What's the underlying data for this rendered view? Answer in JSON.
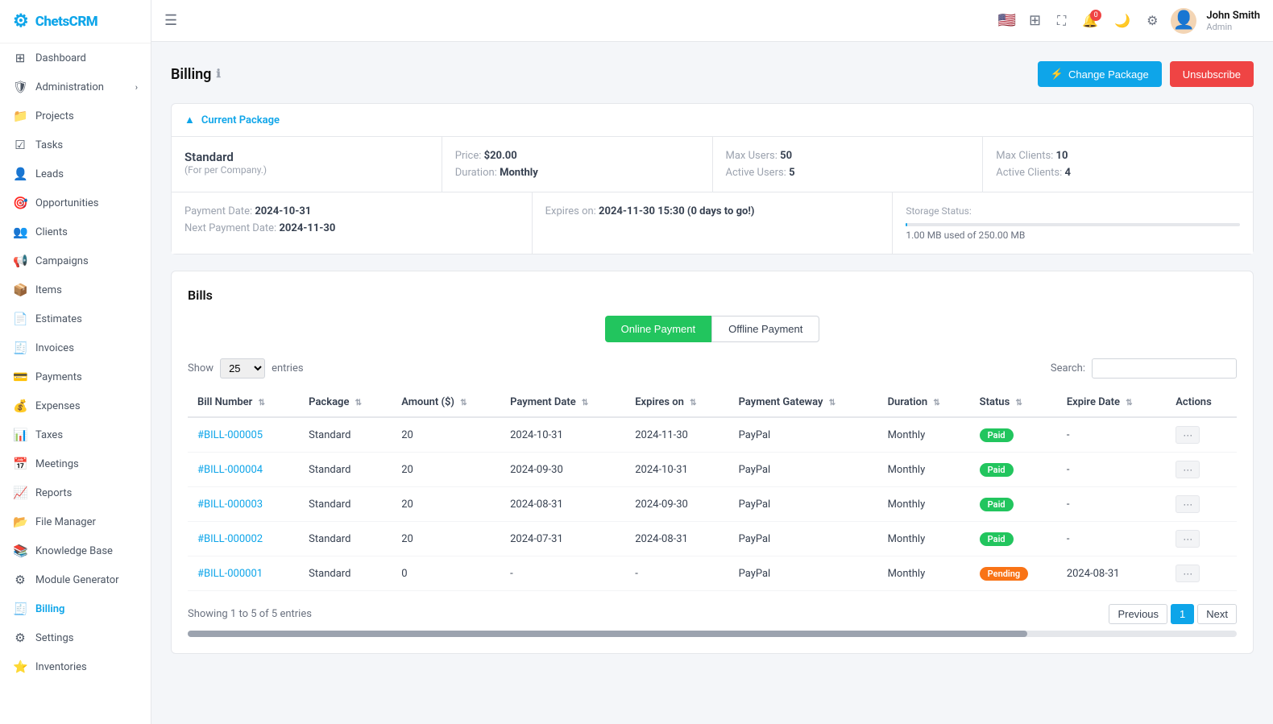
{
  "app": {
    "name": "ChetsCRM",
    "logo_icon": "⚙"
  },
  "topbar": {
    "hamburger_icon": "☰",
    "flag_icon": "🇺🇸",
    "grid_icon": "⊞",
    "fullscreen_icon": "⛶",
    "notification_icon": "🔔",
    "notification_count": "0",
    "moon_icon": "🌙",
    "settings_icon": "⚙",
    "user_name": "John Smith",
    "user_role": "Admin"
  },
  "sidebar": {
    "items": [
      {
        "id": "dashboard",
        "label": "Dashboard",
        "icon": "⊞"
      },
      {
        "id": "administration",
        "label": "Administration",
        "icon": "🛡",
        "has_chevron": true
      },
      {
        "id": "projects",
        "label": "Projects",
        "icon": "📁"
      },
      {
        "id": "tasks",
        "label": "Tasks",
        "icon": "☑"
      },
      {
        "id": "leads",
        "label": "Leads",
        "icon": "👤"
      },
      {
        "id": "opportunities",
        "label": "Opportunities",
        "icon": "🎯"
      },
      {
        "id": "clients",
        "label": "Clients",
        "icon": "👥"
      },
      {
        "id": "campaigns",
        "label": "Campaigns",
        "icon": "📢"
      },
      {
        "id": "items",
        "label": "Items",
        "icon": "📦"
      },
      {
        "id": "estimates",
        "label": "Estimates",
        "icon": "📄"
      },
      {
        "id": "invoices",
        "label": "Invoices",
        "icon": "🧾"
      },
      {
        "id": "payments",
        "label": "Payments",
        "icon": "💳"
      },
      {
        "id": "expenses",
        "label": "Expenses",
        "icon": "💰"
      },
      {
        "id": "taxes",
        "label": "Taxes",
        "icon": "📊"
      },
      {
        "id": "meetings",
        "label": "Meetings",
        "icon": "📅"
      },
      {
        "id": "reports",
        "label": "Reports",
        "icon": "📈"
      },
      {
        "id": "file-manager",
        "label": "File Manager",
        "icon": "📂"
      },
      {
        "id": "knowledge-base",
        "label": "Knowledge Base",
        "icon": "📚"
      },
      {
        "id": "module-generator",
        "label": "Module Generator",
        "icon": "⚙"
      },
      {
        "id": "billing",
        "label": "Billing",
        "icon": "🧾",
        "active": true
      },
      {
        "id": "settings",
        "label": "Settings",
        "icon": "⚙"
      },
      {
        "id": "inventories",
        "label": "Inventories",
        "icon": "⭐"
      }
    ]
  },
  "page": {
    "title": "Billing",
    "change_package_label": "Change Package",
    "unsubscribe_label": "Unsubscribe"
  },
  "current_package": {
    "section_title": "Current Package",
    "package_name": "Standard",
    "package_sub": "(For per Company.)",
    "price_label": "Price:",
    "price_value": "$20.00",
    "duration_label": "Duration:",
    "duration_value": "Monthly",
    "max_users_label": "Max Users:",
    "max_users_value": "50",
    "active_users_label": "Active Users:",
    "active_users_value": "5",
    "max_clients_label": "Max Clients:",
    "max_clients_value": "10",
    "active_clients_label": "Active Clients:",
    "active_clients_value": "4",
    "payment_date_label": "Payment Date:",
    "payment_date_value": "2024-10-31",
    "next_payment_label": "Next Payment Date:",
    "next_payment_value": "2024-11-30",
    "expires_label": "Expires on:",
    "expires_value": "2024-11-30 15:30 (0 days to go!)",
    "storage_label": "Storage Status:",
    "storage_used": "1.00 MB used of 250.00 MB",
    "storage_percent": 0.4
  },
  "bills": {
    "title": "Bills",
    "online_payment": "Online Payment",
    "offline_payment": "Offline Payment",
    "show_label": "Show",
    "entries_label": "entries",
    "search_label": "Search:",
    "show_value": "25",
    "entries_info": "Showing 1 to 5 of 5 entries",
    "columns": [
      "Bill Number",
      "Package",
      "Amount ($)",
      "Payment Date",
      "Expires on",
      "Payment Gateway",
      "Duration",
      "Status",
      "Expire Date",
      "Actions"
    ],
    "rows": [
      {
        "bill_number": "#BILL-000005",
        "package": "Standard",
        "amount": "20",
        "payment_date": "2024-10-31",
        "expires_on": "2024-11-30",
        "gateway": "PayPal",
        "duration": "Monthly",
        "status": "Paid",
        "status_type": "paid",
        "expire_date": "-"
      },
      {
        "bill_number": "#BILL-000004",
        "package": "Standard",
        "amount": "20",
        "payment_date": "2024-09-30",
        "expires_on": "2024-10-31",
        "gateway": "PayPal",
        "duration": "Monthly",
        "status": "Paid",
        "status_type": "paid",
        "expire_date": "-"
      },
      {
        "bill_number": "#BILL-000003",
        "package": "Standard",
        "amount": "20",
        "payment_date": "2024-08-31",
        "expires_on": "2024-09-30",
        "gateway": "PayPal",
        "duration": "Monthly",
        "status": "Paid",
        "status_type": "paid",
        "expire_date": "-"
      },
      {
        "bill_number": "#BILL-000002",
        "package": "Standard",
        "amount": "20",
        "payment_date": "2024-07-31",
        "expires_on": "2024-08-31",
        "gateway": "PayPal",
        "duration": "Monthly",
        "status": "Paid",
        "status_type": "paid",
        "expire_date": "-"
      },
      {
        "bill_number": "#BILL-000001",
        "package": "Standard",
        "amount": "0",
        "payment_date": "-",
        "expires_on": "-",
        "gateway": "PayPal",
        "duration": "Monthly",
        "status": "Pending",
        "status_type": "pending",
        "expire_date": "2024-08-31"
      }
    ],
    "prev_label": "Previous",
    "next_label": "Next",
    "current_page": 1
  }
}
